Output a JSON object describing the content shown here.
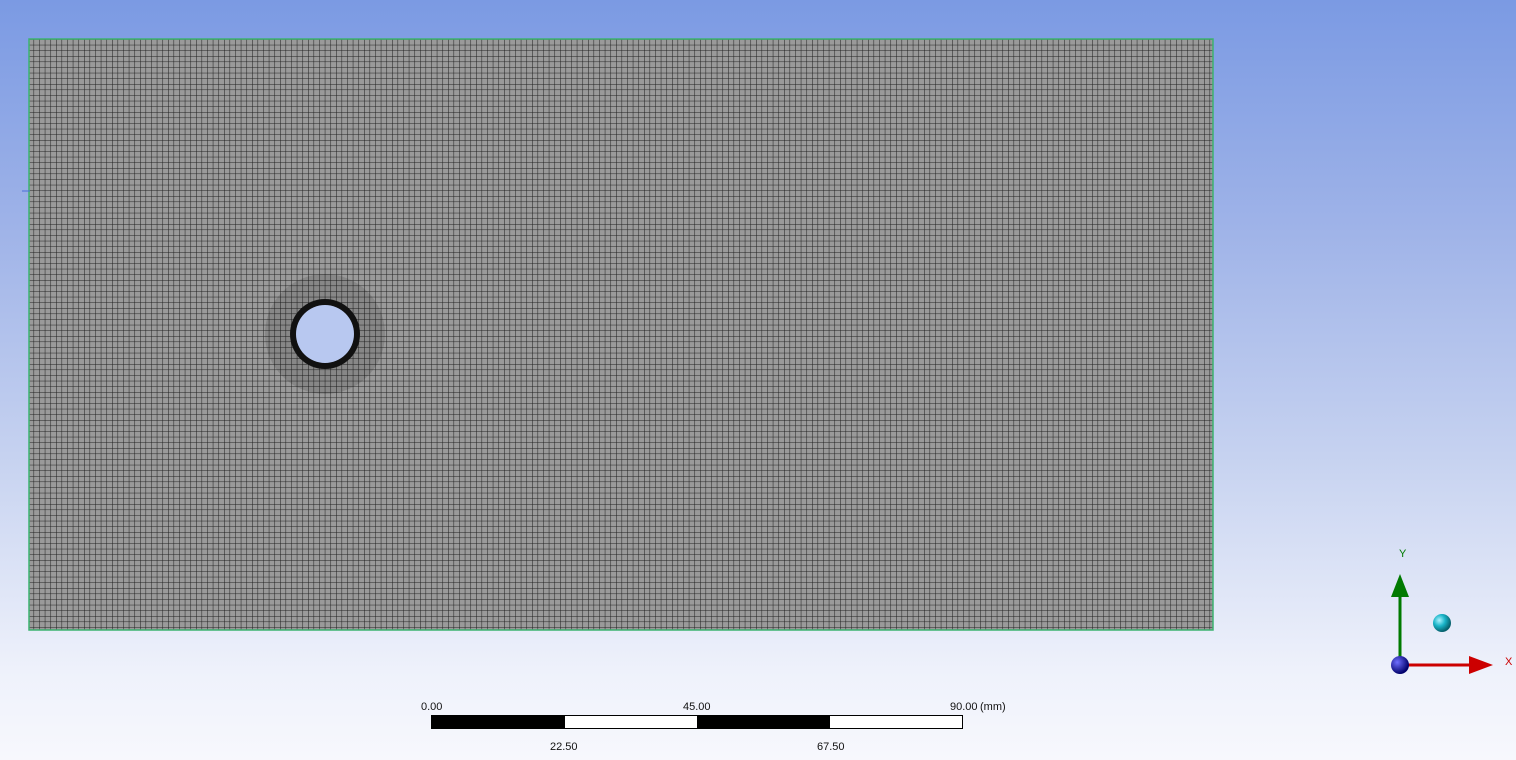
{
  "viewport": {
    "background_top": "#7b9ae3",
    "background_bottom": "#f7f8fd"
  },
  "mesh": {
    "element_fill": "#d8d8d8",
    "grid_line_color": "#2a2a2a",
    "outline_color": "#3cb371",
    "hole_fill": "#b8c8f0",
    "hole_ring_color": "#111111"
  },
  "scale_bar": {
    "top_labels": [
      "0.00",
      "45.00",
      "90.00"
    ],
    "unit": "(mm)",
    "bottom_labels": [
      "22.50",
      "67.50"
    ]
  },
  "triad": {
    "x_label": "X",
    "y_label": "Y",
    "x_color": "#cc0000",
    "y_color": "#007a00",
    "z_color": "#0000aa",
    "iso_ball_color": "#19b4c8"
  }
}
